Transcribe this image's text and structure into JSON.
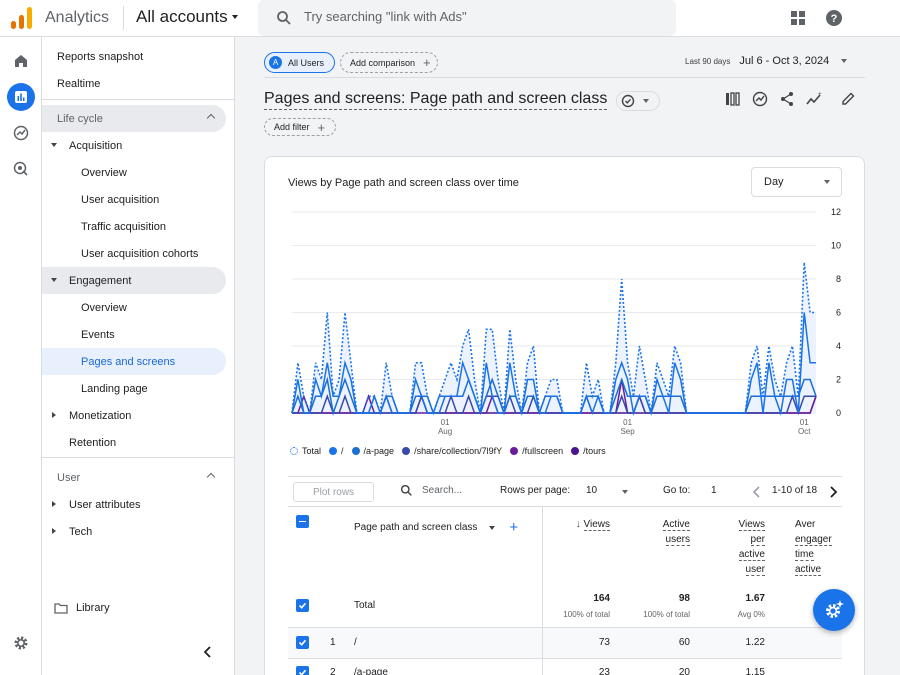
{
  "topbar": {
    "app_name": "Analytics",
    "account": "All accounts",
    "search_placeholder": "Try searching \"link with Ads\""
  },
  "sidebar": {
    "items": [
      {
        "label": "Reports snapshot"
      },
      {
        "label": "Realtime"
      },
      {
        "label": "Life cycle"
      },
      {
        "label": "Acquisition"
      },
      {
        "label": "Overview"
      },
      {
        "label": "User acquisition"
      },
      {
        "label": "Traffic acquisition"
      },
      {
        "label": "User acquisition cohorts"
      },
      {
        "label": "Engagement"
      },
      {
        "label": "Overview"
      },
      {
        "label": "Events"
      },
      {
        "label": "Pages and screens"
      },
      {
        "label": "Landing page"
      },
      {
        "label": "Monetization"
      },
      {
        "label": "Retention"
      },
      {
        "label": "User"
      },
      {
        "label": "User attributes"
      },
      {
        "label": "Tech"
      },
      {
        "label": "Library"
      }
    ]
  },
  "comparison": {
    "all_users": "All Users",
    "avatar_letter": "A",
    "add_comparison": "Add comparison"
  },
  "daterange": {
    "label": "Last 90 days",
    "value": "Jul 6 - Oct 3, 2024"
  },
  "page": {
    "title": "Pages and screens: Page path and screen class",
    "add_filter": "Add filter"
  },
  "chart": {
    "title": "Views by Page path and screen class over time",
    "interval": "Day",
    "y_ticks": [
      "12",
      "10",
      "8",
      "6",
      "4",
      "2",
      "0"
    ],
    "x_ticks": [
      {
        "day": "01",
        "month": "Aug"
      },
      {
        "day": "01",
        "month": "Sep"
      },
      {
        "day": "01",
        "month": "Oct"
      }
    ],
    "legend": [
      "Total",
      "/",
      "/a-page",
      "/share/collection/7l9fY",
      "/fullscreen",
      "/tours"
    ]
  },
  "chart_data": {
    "type": "line",
    "x": [
      "Jul 6",
      "Jul 7",
      "Jul 8",
      "Jul 9",
      "Jul 10",
      "Jul 11",
      "Jul 12",
      "Jul 13",
      "Jul 14",
      "Jul 15",
      "Jul 16",
      "Jul 17",
      "Jul 18",
      "Jul 19",
      "Jul 20",
      "Jul 21",
      "Jul 22",
      "Jul 23",
      "Jul 24",
      "Jul 25",
      "Jul 26",
      "Jul 27",
      "Jul 28",
      "Jul 29",
      "Jul 30",
      "Jul 31",
      "Aug 1",
      "Aug 2",
      "Aug 3",
      "Aug 4",
      "Aug 5",
      "Aug 6",
      "Aug 7",
      "Aug 8",
      "Aug 9",
      "Aug 10",
      "Aug 11",
      "Aug 12",
      "Aug 13",
      "Aug 14",
      "Aug 15",
      "Aug 16",
      "Aug 17",
      "Aug 18",
      "Aug 19",
      "Aug 20",
      "Aug 21",
      "Aug 22",
      "Aug 23",
      "Aug 24",
      "Aug 25",
      "Aug 26",
      "Aug 27",
      "Aug 28",
      "Aug 29",
      "Aug 30",
      "Aug 31",
      "Sep 1",
      "Sep 2",
      "Sep 3",
      "Sep 4",
      "Sep 5",
      "Sep 6",
      "Sep 7",
      "Sep 8",
      "Sep 9",
      "Sep 10",
      "Sep 11",
      "Sep 12",
      "Sep 13",
      "Sep 14",
      "Sep 15",
      "Sep 16",
      "Sep 17",
      "Sep 18",
      "Sep 19",
      "Sep 20",
      "Sep 21",
      "Sep 22",
      "Sep 23",
      "Sep 24",
      "Sep 25",
      "Sep 26",
      "Sep 27",
      "Sep 28",
      "Sep 29",
      "Sep 30",
      "Oct 1",
      "Oct 2",
      "Oct 3"
    ],
    "ylim": [
      0,
      12
    ],
    "y_ticks": [
      0,
      2,
      4,
      6,
      8,
      10,
      12
    ],
    "x_tick_labels": [
      "01 Aug",
      "01 Sep",
      "01 Oct"
    ],
    "series": [
      {
        "name": "Total",
        "values": [
          0,
          3,
          1,
          0,
          3,
          2,
          6,
          1,
          2,
          6,
          3,
          0,
          0,
          1,
          1,
          0,
          3,
          1,
          0,
          0,
          0,
          3,
          3,
          1,
          0,
          1,
          2,
          3,
          2,
          4,
          5,
          2,
          0,
          5,
          5,
          2,
          0,
          5,
          2,
          0,
          3,
          4,
          0,
          1,
          2,
          2,
          0,
          0,
          0,
          0,
          3,
          1,
          2,
          0,
          0,
          3,
          8,
          3,
          1,
          4,
          2,
          0,
          3,
          2,
          1,
          4,
          3,
          0,
          0,
          0,
          0,
          0,
          0,
          0,
          0,
          0,
          0,
          0,
          3,
          4,
          1,
          4,
          2,
          1,
          3,
          4,
          1,
          9,
          6,
          6
        ]
      },
      {
        "name": "/",
        "values": [
          0,
          2,
          0,
          0,
          2,
          1,
          3,
          1,
          1,
          3,
          2,
          0,
          0,
          0,
          1,
          0,
          1,
          0,
          0,
          0,
          0,
          2,
          1,
          0,
          0,
          1,
          1,
          1,
          1,
          3,
          2,
          1,
          0,
          3,
          1,
          0,
          0,
          3,
          1,
          0,
          2,
          2,
          0,
          0,
          1,
          1,
          0,
          0,
          0,
          0,
          1,
          0,
          1,
          0,
          0,
          2,
          3,
          2,
          0,
          1,
          1,
          0,
          2,
          1,
          0,
          3,
          2,
          0,
          0,
          0,
          0,
          0,
          0,
          0,
          0,
          0,
          0,
          0,
          2,
          3,
          0,
          3,
          1,
          0,
          2,
          2,
          0,
          6,
          3,
          3
        ]
      },
      {
        "name": "/a-page",
        "values": [
          0,
          1,
          0,
          0,
          1,
          1,
          2,
          0,
          1,
          2,
          1,
          0,
          0,
          0,
          0,
          0,
          1,
          1,
          0,
          0,
          0,
          1,
          1,
          1,
          0,
          0,
          1,
          1,
          1,
          1,
          2,
          1,
          0,
          1,
          2,
          1,
          0,
          1,
          1,
          0,
          1,
          1,
          0,
          1,
          1,
          1,
          0,
          0,
          0,
          0,
          1,
          1,
          1,
          0,
          0,
          1,
          2,
          1,
          1,
          1,
          1,
          0,
          1,
          1,
          1,
          1,
          1,
          0,
          0,
          0,
          0,
          0,
          0,
          0,
          0,
          0,
          0,
          0,
          1,
          1,
          1,
          1,
          1,
          1,
          1,
          1,
          1,
          2,
          2,
          1
        ]
      },
      {
        "name": "/share/collection/7l9fY",
        "values": [
          0,
          0,
          0,
          0,
          0,
          0,
          1,
          0,
          0,
          1,
          0,
          0,
          0,
          0,
          0,
          0,
          0,
          0,
          0,
          0,
          0,
          0,
          1,
          0,
          0,
          0,
          0,
          1,
          0,
          0,
          1,
          0,
          0,
          1,
          1,
          1,
          0,
          1,
          0,
          0,
          0,
          1,
          0,
          0,
          0,
          0,
          0,
          0,
          0,
          0,
          1,
          0,
          0,
          0,
          0,
          0,
          1,
          0,
          0,
          1,
          0,
          0,
          0,
          0,
          0,
          0,
          0,
          0,
          0,
          0,
          0,
          0,
          0,
          0,
          0,
          0,
          0,
          0,
          0,
          0,
          0,
          0,
          0,
          0,
          0,
          1,
          0,
          1,
          1,
          1
        ]
      },
      {
        "name": "/fullscreen",
        "values": [
          0,
          0,
          1,
          0,
          0,
          0,
          0,
          0,
          0,
          0,
          0,
          0,
          0,
          1,
          0,
          0,
          1,
          0,
          0,
          0,
          0,
          0,
          0,
          0,
          0,
          0,
          0,
          0,
          0,
          0,
          0,
          0,
          0,
          0,
          1,
          0,
          0,
          0,
          0,
          0,
          0,
          0,
          0,
          0,
          0,
          0,
          0,
          0,
          0,
          0,
          0,
          0,
          0,
          0,
          0,
          0,
          2,
          0,
          0,
          1,
          0,
          0,
          0,
          0,
          0,
          0,
          0,
          0,
          0,
          0,
          0,
          0,
          0,
          0,
          0,
          0,
          0,
          0,
          0,
          0,
          0,
          0,
          0,
          0,
          0,
          0,
          0,
          0,
          0,
          1
        ]
      },
      {
        "name": "/tours",
        "values": [
          0,
          0,
          0,
          0,
          0,
          0,
          0,
          0,
          0,
          0,
          0,
          0,
          0,
          0,
          0,
          0,
          0,
          0,
          0,
          0,
          0,
          0,
          1,
          0,
          0,
          0,
          0,
          0,
          0,
          0,
          0,
          0,
          0,
          0,
          0,
          0,
          0,
          0,
          0,
          0,
          0,
          0,
          0,
          0,
          0,
          0,
          0,
          0,
          0,
          0,
          0,
          0,
          0,
          0,
          0,
          0,
          0,
          0,
          0,
          0,
          0,
          0,
          0,
          0,
          0,
          0,
          0,
          0,
          0,
          0,
          0,
          0,
          0,
          0,
          0,
          0,
          0,
          0,
          0,
          0,
          0,
          0,
          0,
          0,
          0,
          0,
          0,
          0,
          0,
          1
        ]
      }
    ]
  },
  "colors": {
    "accent": "#1a73e8",
    "series": [
      "#1a73e8",
      "#1a73e8",
      "#1a6fd1",
      "#3949ab",
      "#6a1b9a",
      "#4a148c"
    ]
  },
  "table_controls": {
    "plot_rows": "Plot rows",
    "search_placeholder": "Search...",
    "rows_per_page_label": "Rows per page:",
    "rows_per_page": "10",
    "goto_label": "Go to:",
    "goto_value": "1",
    "range": "1-10 of 18"
  },
  "table": {
    "dimension_header": "Page path and screen class",
    "col_views": "Views",
    "col_active_users": [
      "Active",
      "users"
    ],
    "col_views_per_user": [
      "Views",
      "per",
      "active",
      "user"
    ],
    "col_avg_engagement": [
      "Aver",
      "engager",
      "time",
      "active"
    ],
    "total_label": "Total",
    "totals": {
      "views": "164",
      "views_sub": "100% of total",
      "users": "98",
      "users_sub": "100% of total",
      "vpu": "1.67",
      "vpu_sub": "Avg 0%"
    },
    "rows": [
      {
        "index": "1",
        "path": "/",
        "views": "73",
        "users": "60",
        "vpu": "1.22"
      },
      {
        "index": "2",
        "path": "/a-page",
        "views": "23",
        "users": "20",
        "vpu": "1.15"
      }
    ]
  }
}
